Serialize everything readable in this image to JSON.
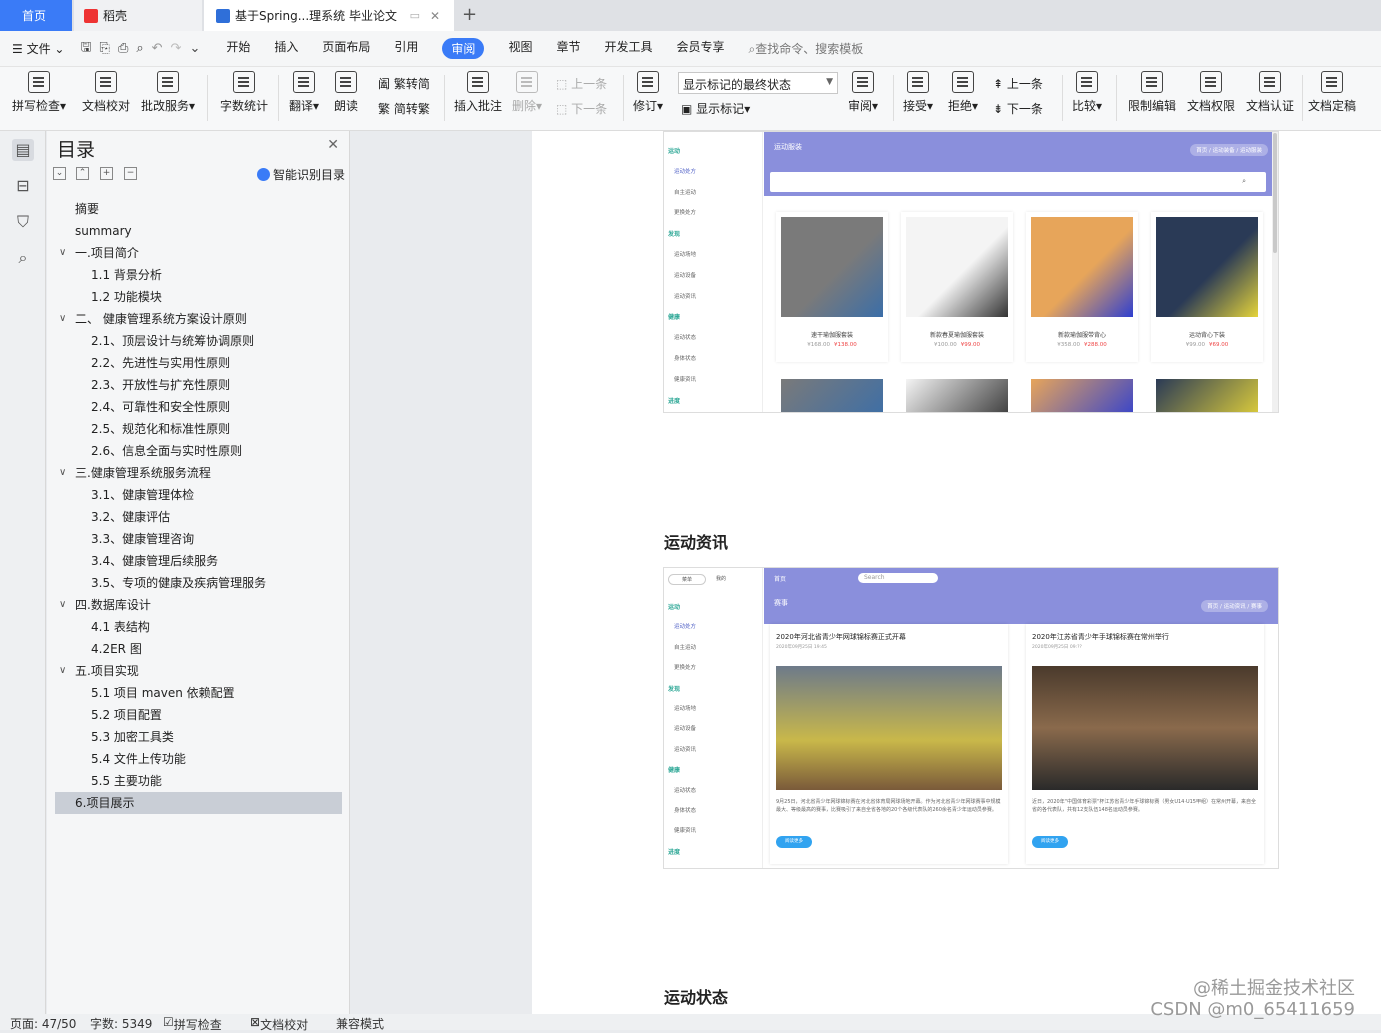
{
  "tabs": {
    "home": "首页",
    "daoke": "稻壳",
    "doc": "基于Spring...理系统 毕业论文"
  },
  "menu": {
    "file": "文件",
    "items": [
      "开始",
      "插入",
      "页面布局",
      "引用",
      "审阅",
      "视图",
      "章节",
      "开发工具",
      "会员专享"
    ],
    "active": "审阅",
    "search": "查找命令、搜索模板"
  },
  "ribbon": {
    "spell": "拼写检查",
    "proofread": "文档校对",
    "batch": "批改服务",
    "wordcount": "字数统计",
    "translate": "翻译",
    "read": "朗读",
    "trad": "繁转简",
    "simp": "简转繁",
    "insert_comment": "插入批注",
    "delete": "删除",
    "prev_comment": "上一条",
    "next_comment": "下一条",
    "track": "修订",
    "mark_state": "显示标记的最终状态",
    "show_marks": "显示标记",
    "review": "审阅",
    "accept": "接受",
    "reject": "拒绝",
    "prev": "上一条",
    "next": "下一条",
    "compare": "比较",
    "restrict": "限制编辑",
    "permission": "文档权限",
    "certify": "文档认证",
    "finalize": "文档定稿"
  },
  "nav": {
    "title": "目录",
    "smart": "智能识别目录",
    "toc": [
      {
        "text": "摘要",
        "level": 1
      },
      {
        "text": "summary",
        "level": 1
      },
      {
        "text": "一.项目简介",
        "level": 0
      },
      {
        "text": "1.1 背景分析",
        "level": 2
      },
      {
        "text": "1.2 功能模块",
        "level": 2
      },
      {
        "text": "二、 健康管理系统方案设计原则",
        "level": 0
      },
      {
        "text": "2.1、顶层设计与统筹协调原则",
        "level": 2
      },
      {
        "text": "2.2、先进性与实用性原则",
        "level": 2
      },
      {
        "text": "2.3、开放性与扩充性原则",
        "level": 2
      },
      {
        "text": "2.4、可靠性和安全性原则",
        "level": 2
      },
      {
        "text": "2.5、规范化和标准性原则",
        "level": 2
      },
      {
        "text": "2.6、信息全面与实时性原则",
        "level": 2
      },
      {
        "text": "三.健康管理系统服务流程",
        "level": 0
      },
      {
        "text": "3.1、健康管理体检",
        "level": 2
      },
      {
        "text": "3.2、健康评估",
        "level": 2
      },
      {
        "text": "3.3、健康管理咨询",
        "level": 2
      },
      {
        "text": "3.4、健康管理后续服务",
        "level": 2
      },
      {
        "text": "3.5、专项的健康及疾病管理服务",
        "level": 2
      },
      {
        "text": "四.数据库设计",
        "level": 0
      },
      {
        "text": "4.1 表结构",
        "level": 2
      },
      {
        "text": "4.2ER 图",
        "level": 2
      },
      {
        "text": "五.项目实现",
        "level": 0
      },
      {
        "text": "5.1 项目 maven 依赖配置",
        "level": 2
      },
      {
        "text": "5.2 项目配置",
        "level": 2
      },
      {
        "text": "5.3 加密工具类",
        "level": 2
      },
      {
        "text": "5.4 文件上传功能",
        "level": 2
      },
      {
        "text": "5.5 主要功能",
        "level": 2
      },
      {
        "text": "6.项目展示",
        "level": 1,
        "selected": true
      }
    ]
  },
  "doc": {
    "shot1": {
      "banner_title": "运动服装",
      "crumb": "首页 / 运动装备 / 运动服装",
      "side": [
        "运动",
        "运动处方",
        "自主运动",
        "更换处方",
        "发现",
        "运动场地",
        "运动设备",
        "运动资讯",
        "健康",
        "运动状态",
        "身体状态",
        "健康资讯",
        "进度"
      ],
      "cards": [
        {
          "name": "速干瑜伽服套装",
          "old": "¥168.00",
          "price": "¥138.00"
        },
        {
          "name": "新款春夏瑜伽服套装",
          "old": "¥100.00",
          "price": "¥99.00"
        },
        {
          "name": "新款瑜伽服带背心",
          "old": "¥358.00",
          "price": "¥288.00"
        },
        {
          "name": "运动背心下装",
          "old": "¥99.00",
          "price": "¥69.00"
        }
      ]
    },
    "section1": "运动资讯",
    "shot2": {
      "nav_home": "首页",
      "search": "Search",
      "banner_title": "赛事",
      "crumb": "首页 / 运动资讯 / 赛事",
      "menu_tab": "菜单",
      "mine_tab": "我的",
      "news": [
        {
          "title": "2020年河北省青少年网球锦标赛正式开幕",
          "meta": "2020年09月25日 19:45",
          "desc": "9月25日，河北省青少年网球锦标赛在河北省体育局网球场地开幕。作为河北省青少年网球赛事中规模最大、等级最高的赛事，比赛吸引了来自全省各地的20个各级代表队的260余名青少年运动员参赛。",
          "btn": "阅读更多"
        },
        {
          "title": "2020年江苏省青少年手球锦标赛在常州举行",
          "meta": "2020年09月25日 09:??",
          "desc": "近日，2020年\"中国体育彩票\"杯江苏省青少年手球锦标赛（男女U14·U15甲组）在常州开幕，来自全省的各代表队，共有12支队伍148名运动员参赛。",
          "btn": "阅读更多"
        }
      ]
    },
    "section2": "运动状态"
  },
  "status": {
    "page": "页面: 47/50",
    "words": "字数: 5349",
    "spell": "拼写检查",
    "proof": "文档校对",
    "compat": "兼容模式"
  },
  "watermark": {
    "line1": "@稀土掘金技术社区",
    "line2": "CSDN @m0_65411659"
  },
  "colors": {
    "accent": "#3a7bf7",
    "banner": "#8a8fdc",
    "green": "#33aa99"
  }
}
